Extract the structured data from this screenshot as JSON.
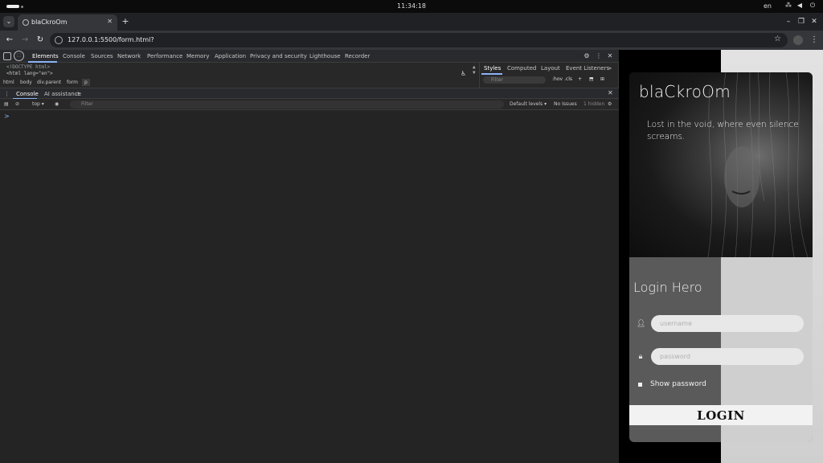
{
  "system": {
    "clock": "11:34:18",
    "lang": "en"
  },
  "browser": {
    "tab_title": "blaCkroOm",
    "url": "127.0.0.1:5500/form.html?"
  },
  "devtools": {
    "tabs": [
      "Elements",
      "Console",
      "Sources",
      "Network",
      "Performance",
      "Memory",
      "Application",
      "Privacy and security",
      "Lighthouse",
      "Recorder"
    ],
    "elements": {
      "doctype": "<!DOCTYPE html>",
      "html_tag": "<html lang=\"en\">"
    },
    "breadcrumbs": [
      "html",
      "body",
      "div.parent",
      "form",
      "p"
    ],
    "styles_tabs": [
      "Styles",
      "Computed",
      "Layout",
      "Event Listeners"
    ],
    "styles_filter_placeholder": "Filter",
    "hov": ":hov",
    "cls": ".cls",
    "drawer_tabs": [
      "Console",
      "AI assistance"
    ],
    "console": {
      "context": "top",
      "filter_placeholder": "Filter",
      "levels": "Default levels",
      "issues": "No Issues",
      "hidden": "1 hidden",
      "prompt": ">"
    }
  },
  "page": {
    "brand": "blaCkroOm",
    "tagline": "Lost in the void, where even silence screams.",
    "login_title": "Login Hero",
    "username_placeholder": "username",
    "password_placeholder": "password",
    "show_password": "Show password",
    "login_button": "LOGIN"
  }
}
